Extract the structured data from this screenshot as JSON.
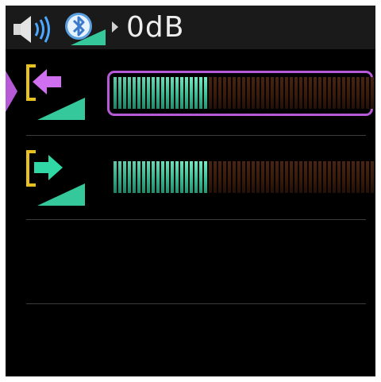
{
  "header": {
    "icons": [
      "speaker-icon",
      "bluetooth-icon",
      "play-arrow-icon"
    ],
    "volume_label": "0dB"
  },
  "colors": {
    "screen_bg": "#000000",
    "header_bg": "#1a1a1a",
    "accent_purple": "#b65ad8",
    "input_arrow": "#d070f0",
    "output_arrow": "#2fd8a4",
    "bracket_yellow": "#e8c020",
    "meter_active": "#34c89a",
    "meter_inactive": "#3a1a08",
    "divider": "#3c3c3c"
  },
  "rows": [
    {
      "name": "input",
      "icon": "input-arrow-icon",
      "level_fraction": 0.36,
      "segments": 55,
      "selected": true
    },
    {
      "name": "output",
      "icon": "output-arrow-icon",
      "level_fraction": 0.36,
      "segments": 55,
      "selected": false
    }
  ]
}
